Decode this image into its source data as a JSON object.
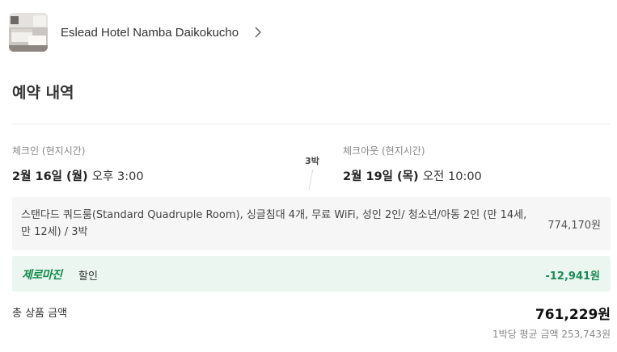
{
  "hotel": {
    "name": "Eslead Hotel Namba Daikokucho"
  },
  "section_title": "예약 내역",
  "checkin": {
    "label": "체크인 (현지시간)",
    "date": "2월 16일 (월)",
    "time": "오후 3:00"
  },
  "nights": "3박",
  "checkout": {
    "label": "체크아웃 (현지시간)",
    "date": "2월 19일 (목)",
    "time": "오전 10:00"
  },
  "room": {
    "description": "스탠다드 쿼드룸(Standard Quadruple Room), 싱글침대 4개, 무료 WiFi, 성인 2인/ 청소년/아동 2인 (만 14세, 만 12세) / 3박",
    "price": "774,170원"
  },
  "discount": {
    "brand": "제로마진",
    "label": "할인",
    "amount": "-12,941원",
    "color": "#0f8a4a"
  },
  "total": {
    "label": "총 상품 금액",
    "amount": "761,229원",
    "per_night": "1박당 평균 금액 253,743원"
  }
}
